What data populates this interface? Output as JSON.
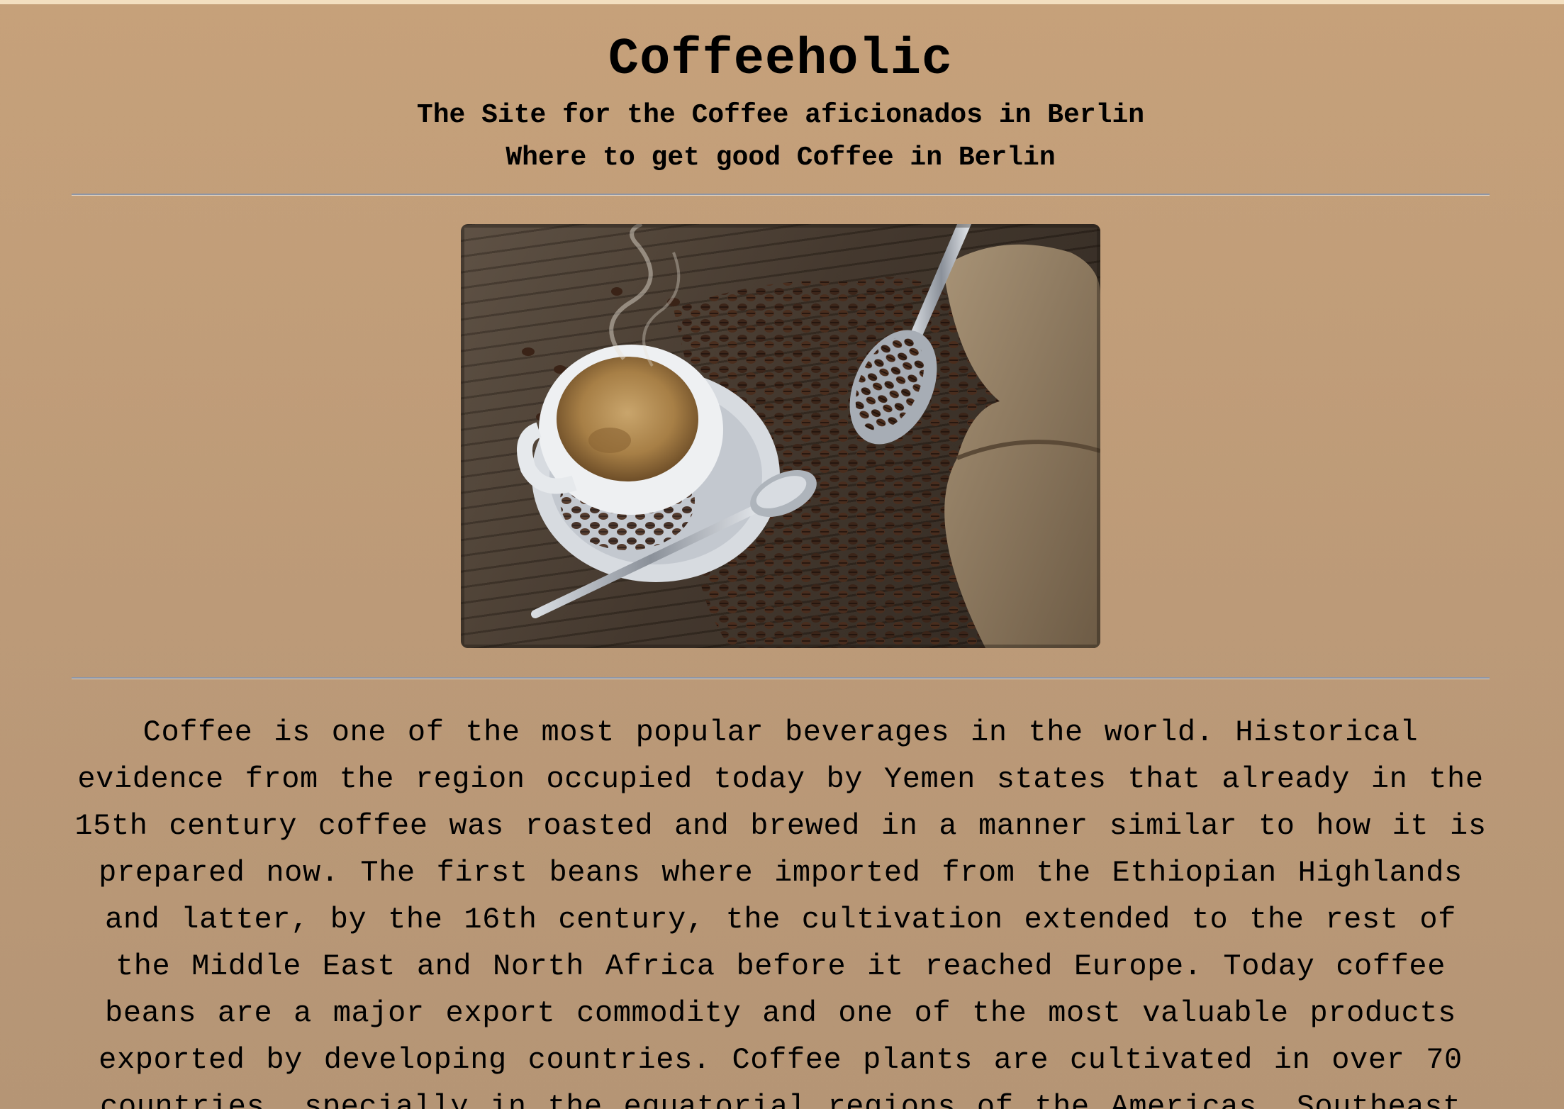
{
  "header": {
    "title": "Coffeeholic",
    "subtitle": "The Site for the Coffee aficionados in Berlin",
    "tagline": "Where to get good Coffee in Berlin"
  },
  "hero_image": {
    "alt": "coffee-cup-with-beans-photo"
  },
  "intro": {
    "text": "Coffee is one of the most popular beverages in the world. Historical evidence from the region occupied today by Yemen states that already in the 15th century coffee was roasted and brewed in a manner similar to how it is prepared now. The first beans where imported from the Ethiopian Highlands and latter, by the 16th century, the cultivation extended to the rest of the Middle East and North Africa before it reached Europe. Today coffee beans are a major export commodity and one of the most valuable products exported by developing countries. Coffee plants are cultivated in over 70 countries, specially in the equatorial regions of the Americas, Southeast"
  },
  "colors": {
    "background_top": "#c6a17a",
    "background_bottom": "#b59575",
    "rule": "#8e96a6",
    "text": "#000000"
  }
}
